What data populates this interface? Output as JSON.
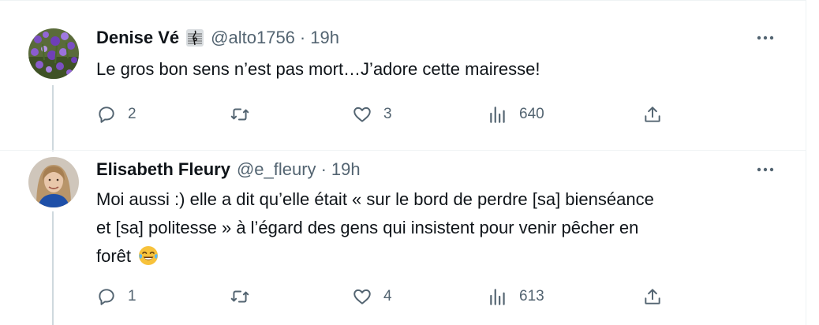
{
  "tweets": [
    {
      "author": "Denise Vé",
      "badge_icon": "music-clef-icon",
      "handle": "@alto1756",
      "separator": "·",
      "time": "19h",
      "text": "Le gros bon sens n’est pas mort…J’adore cette mairesse!",
      "replies": "2",
      "reposts": "",
      "likes": "3",
      "views": "640"
    },
    {
      "author": "Elisabeth Fleury",
      "handle": "@e_fleury",
      "separator": "·",
      "time": "19h",
      "text_lines": [
        "Moi aussi :) elle a dit qu’elle était « sur le bord de perdre [sa] bienséance",
        "et [sa] politesse » à l’égard des gens qui insistent pour venir pêcher en",
        "forêt"
      ],
      "emoji": "tears-of-joy-emoji",
      "replies": "1",
      "reposts": "",
      "likes": "4",
      "views": "613"
    }
  ],
  "colors": {
    "text": "#0f1419",
    "secondary": "#536471",
    "border": "#eff3f4",
    "thread": "#cfd9de"
  }
}
